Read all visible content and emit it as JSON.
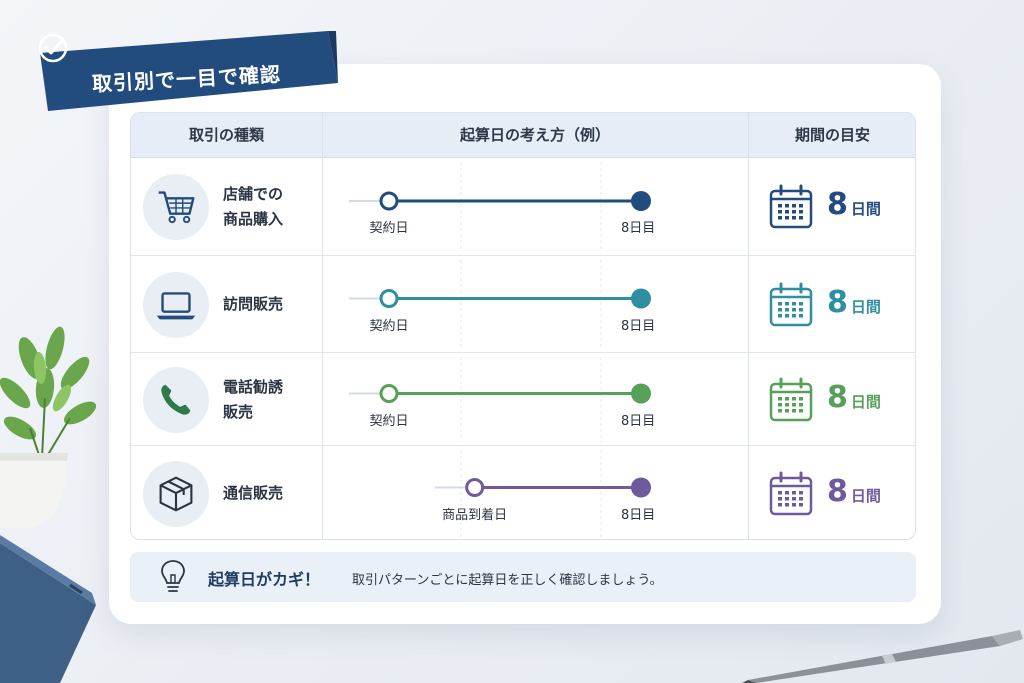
{
  "banner": {
    "title": "取引別で一目で確認"
  },
  "table": {
    "headers": {
      "type": "取引の種類",
      "start": "起算日の考え方（例）",
      "period": "期間の目安"
    },
    "rows": [
      {
        "type": "店舗での\n商品購入",
        "icon": "shopping-cart-icon",
        "start_label": "契約日",
        "end_label": "8日目",
        "start_fraction": 0.0,
        "period_number": "8",
        "period_unit": "日間",
        "color": "#234c7e"
      },
      {
        "type": "訪問販売",
        "icon": "laptop-icon",
        "start_label": "契約日",
        "end_label": "8日目",
        "start_fraction": 0.0,
        "period_number": "8",
        "period_unit": "日間",
        "color": "#2f8fa0"
      },
      {
        "type": "電話勧誘\n販売",
        "icon": "phone-icon",
        "start_label": "契約日",
        "end_label": "8日目",
        "start_fraction": 0.0,
        "period_number": "8",
        "period_unit": "日間",
        "color": "#56a05a"
      },
      {
        "type": "通信販売",
        "icon": "package-box-icon",
        "start_label": "商品到着日",
        "end_label": "8日目",
        "start_fraction": 0.34,
        "period_number": "8",
        "period_unit": "日間",
        "color": "#6f5a9c"
      }
    ]
  },
  "tip": {
    "title": "起算日がカギ！",
    "text": "取引パターンごとに起算日を正しく確認しましょう。"
  },
  "colors": {
    "banner": "#234c7e",
    "header_bg": "#e6edf6",
    "tip_bg": "#eaf0f7"
  }
}
